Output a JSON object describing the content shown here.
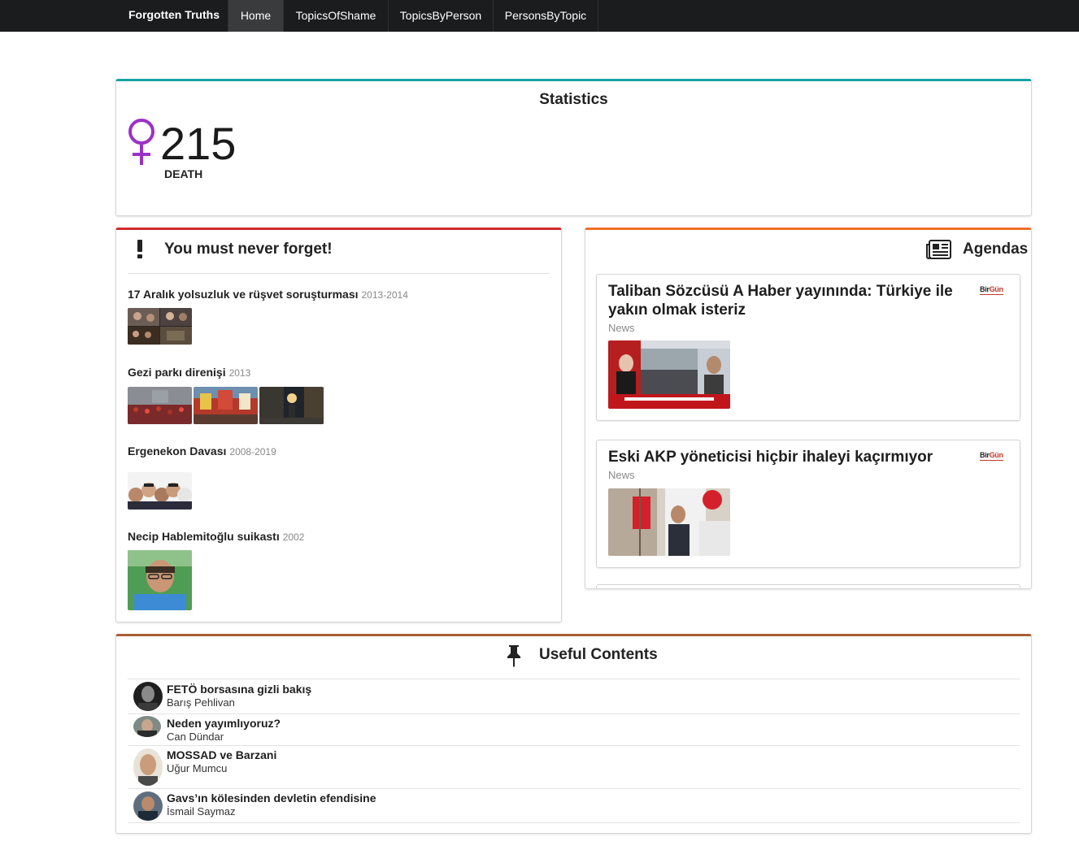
{
  "navbar": {
    "brand": "Forgotten Truths",
    "items": [
      "Home",
      "TopicsOfShame",
      "TopicsByPerson",
      "PersonsByTopic"
    ],
    "active": "Home"
  },
  "statistics": {
    "title": "Statistics",
    "icon": "venus-icon",
    "value": "215",
    "label": "DEATH"
  },
  "never_forget": {
    "title": "You must never forget!",
    "icon": "exclamation-icon",
    "topics": [
      {
        "title": "17 Aralık yolsuzluk ve rüşvet soruşturması",
        "years": "2013-2014"
      },
      {
        "title": "Gezi parkı direnişi",
        "years": "2013"
      },
      {
        "title": "Ergenekon Davası",
        "years": "2008-2019"
      },
      {
        "title": "Necip Hablemitoğlu suikastı",
        "years": "2002"
      }
    ]
  },
  "agendas": {
    "title": "Agendas",
    "icon": "newspaper-icon",
    "items": [
      {
        "title": "Taliban Sözcüsü A Haber yayınında: Türkiye ile yakın olmak isteriz",
        "category": "News",
        "source": "BirGün"
      },
      {
        "title": "Eski AKP yöneticisi hiçbir ihaleyi kaçırmıyor",
        "category": "News",
        "source": "BirGün"
      }
    ]
  },
  "useful_contents": {
    "title": "Useful Contents",
    "icon": "pin-icon",
    "items": [
      {
        "title": "FETÖ borsasına gizli bakış",
        "author": "Barış Pehlivan"
      },
      {
        "title": "Neden yayımlıyoruz?",
        "author": "Can Dündar"
      },
      {
        "title": "MOSSAD ve Barzani",
        "author": "Uğur Mumcu"
      },
      {
        "title": "Gavs’ın kölesinden devletin efendisine",
        "author": "İsmail Saymaz"
      }
    ]
  },
  "colors": {
    "navbar_bg": "#1b1c1d",
    "statistics_accent": "#16a4a2",
    "never_forget_accent": "#d32a2a",
    "agendas_accent": "#ef6f2c",
    "useful_accent": "#a86036",
    "venus_icon": "#9b30c8",
    "source_logo_red": "#c0392b"
  }
}
